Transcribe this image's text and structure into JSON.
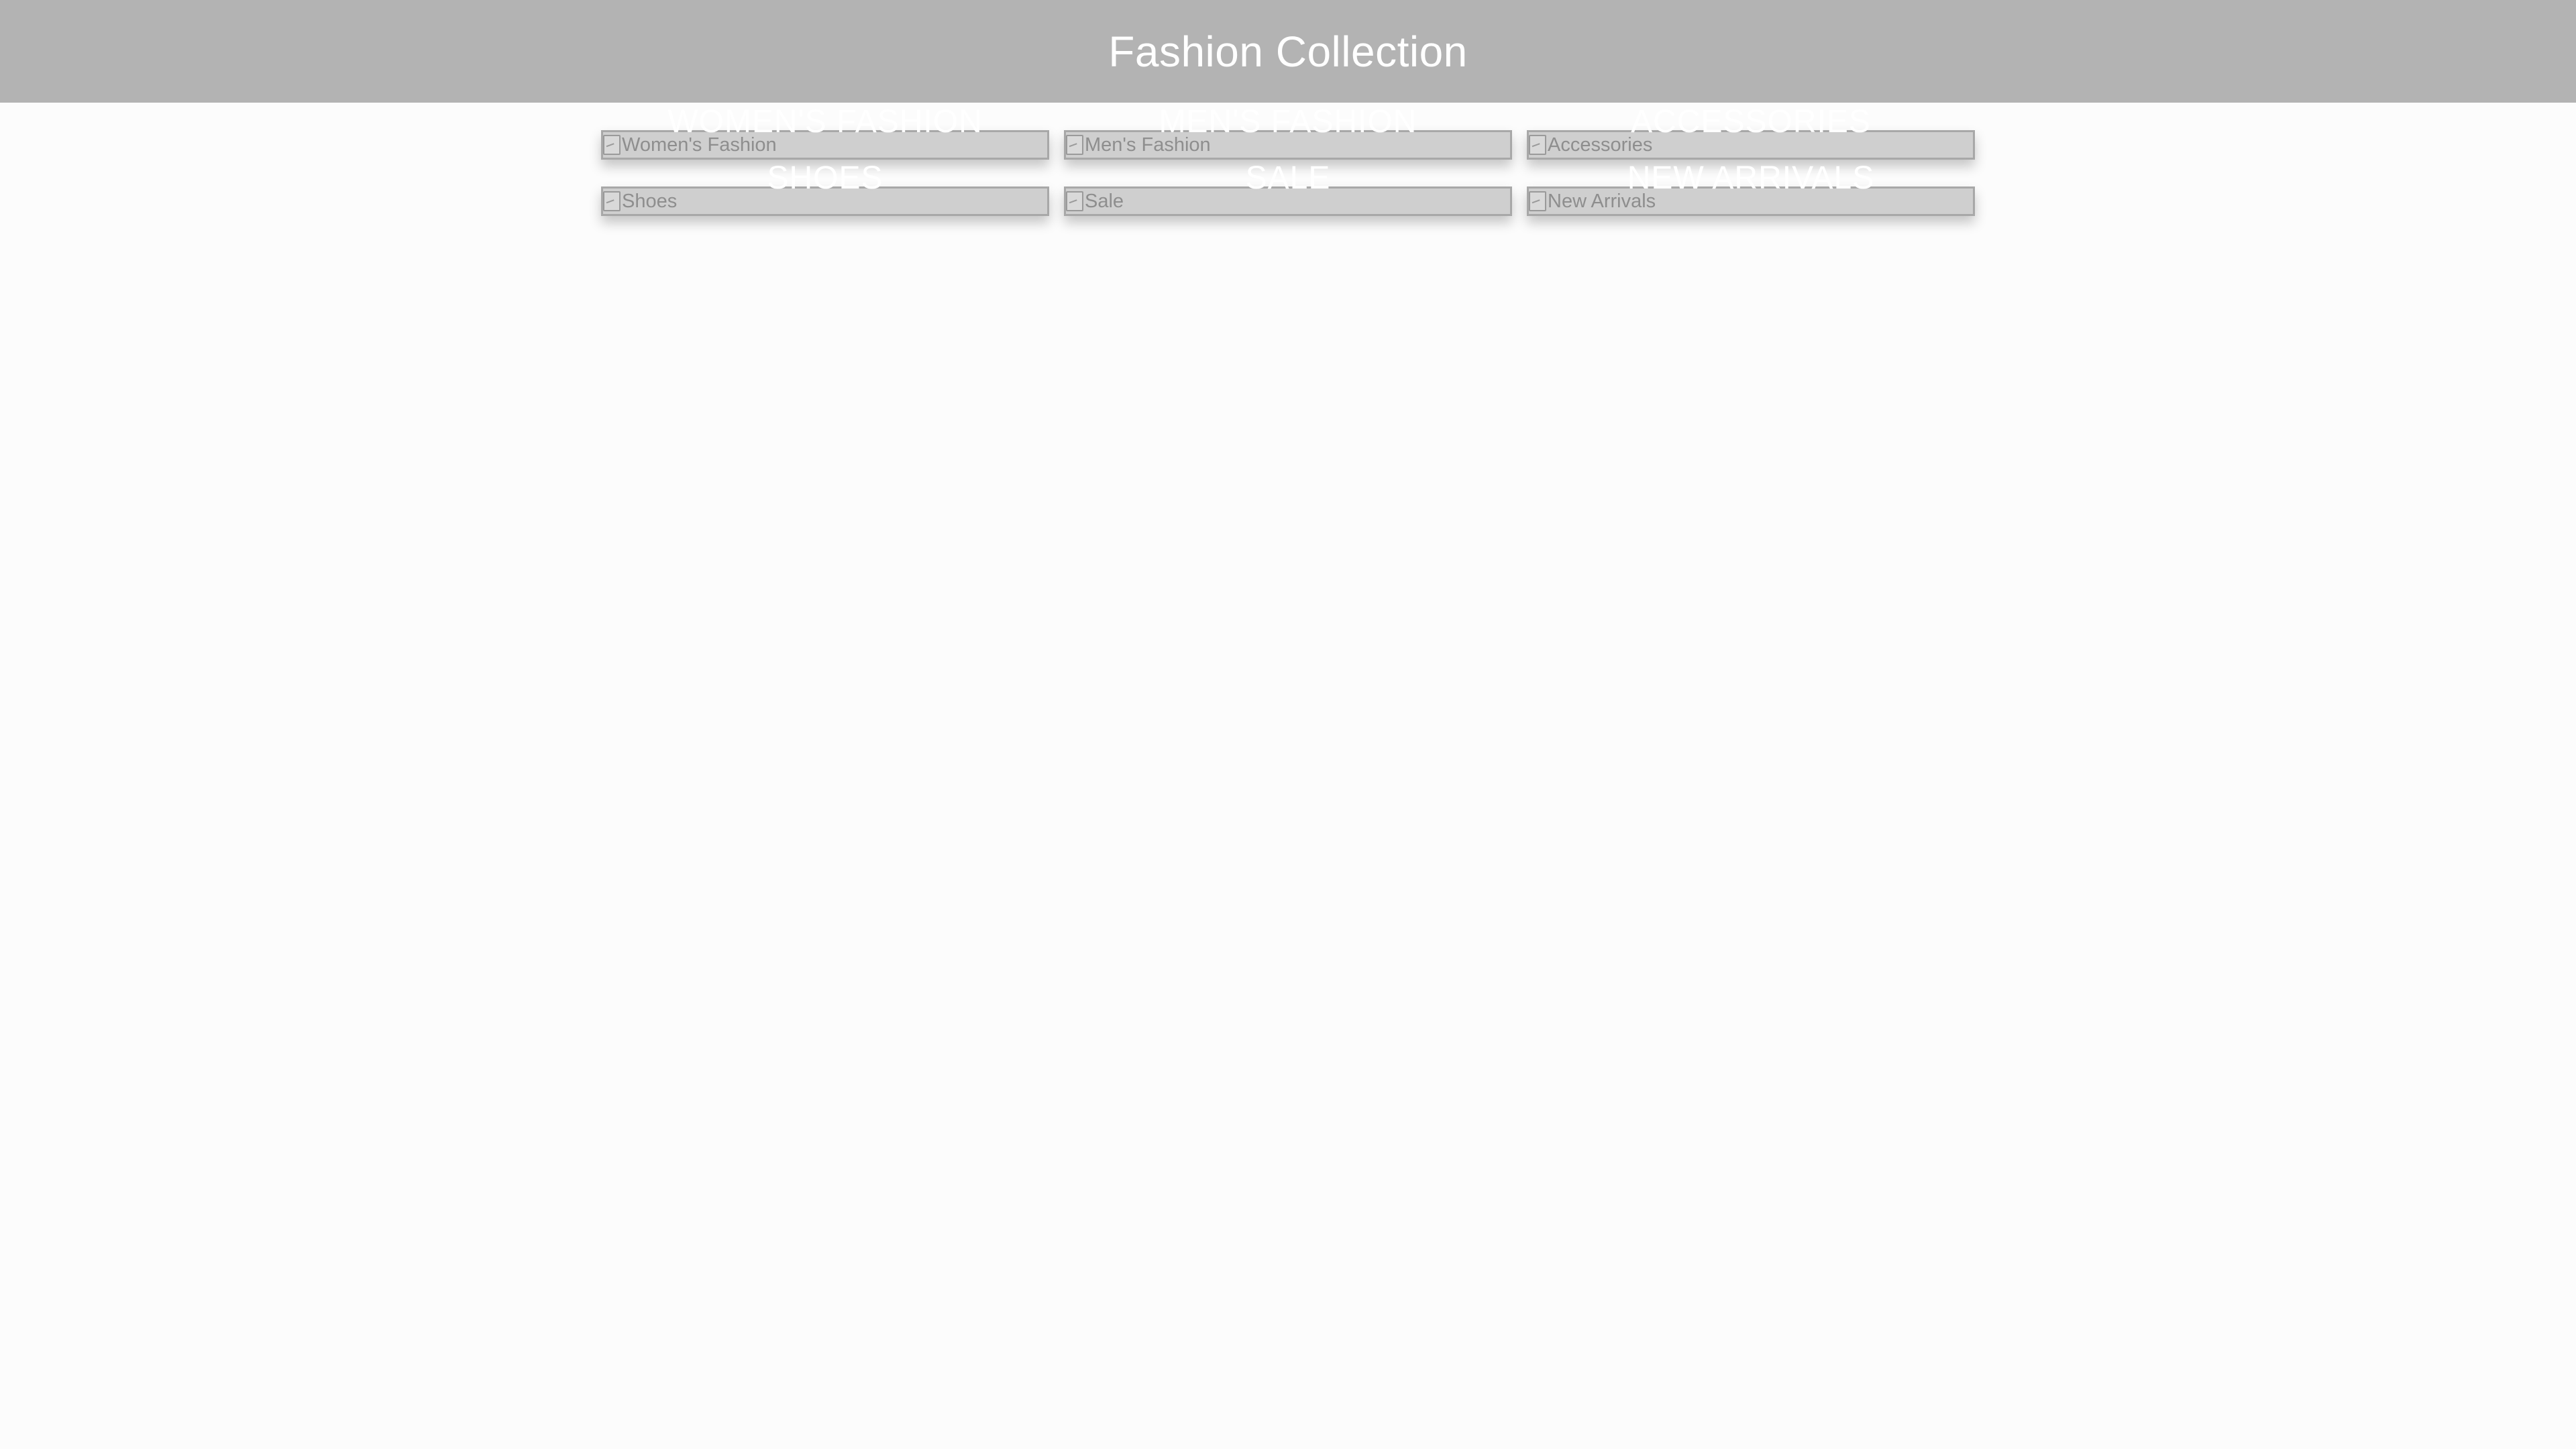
{
  "header": {
    "title": "Fashion Collection"
  },
  "categories": [
    {
      "alt": "Women's Fashion",
      "label": "Women's Fashion"
    },
    {
      "alt": "Men's Fashion",
      "label": "Men's Fashion"
    },
    {
      "alt": "Accessories",
      "label": "Accessories"
    },
    {
      "alt": "Shoes",
      "label": "Shoes"
    },
    {
      "alt": "Sale",
      "label": "Sale"
    },
    {
      "alt": "New Arrivals",
      "label": "New Arrivals"
    }
  ],
  "colors": {
    "header_bg": "#b3b3b3",
    "page_bg": "#fcfcfc",
    "tile_bg": "#cfcfcf",
    "label_text": "#ffffff"
  },
  "icons": {
    "tile_image": "broken-image-icon"
  }
}
